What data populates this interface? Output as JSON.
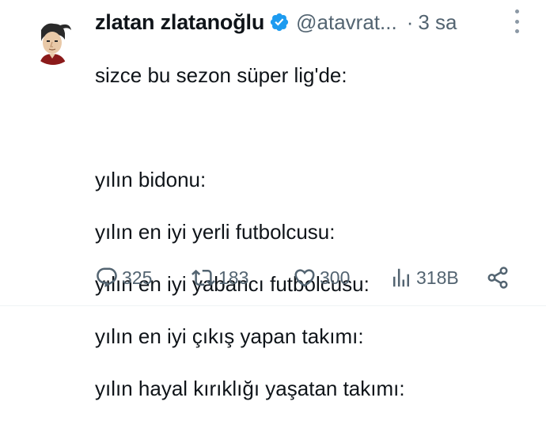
{
  "tweet": {
    "display_name": "zlatan zlatanoğlu",
    "handle": "@atavrat...",
    "separator": "·",
    "time": "3 sa",
    "text_lines": [
      "sizce bu sezon süper lig'de:",
      "",
      "yılın bidonu:",
      "yılın en iyi yerli futbolcusu:",
      "yılın en iyi yabancı futbolcusu:",
      "yılın en iyi çıkış yapan takımı:",
      "yılın hayal kırıklığı yaşatan takımı:"
    ],
    "verified_color": "#1d9bf0"
  },
  "actions": {
    "replies": "325",
    "retweets": "183",
    "likes": "300",
    "views": "318B"
  },
  "icons": {
    "reply": "reply-icon",
    "retweet": "retweet-icon",
    "like": "heart-icon",
    "views": "views-bar-chart-icon",
    "share": "share-icon",
    "more": "more-vertical-icon",
    "verified": "verified-badge-icon"
  },
  "colors": {
    "text": "#0f1419",
    "secondary": "#536471"
  }
}
